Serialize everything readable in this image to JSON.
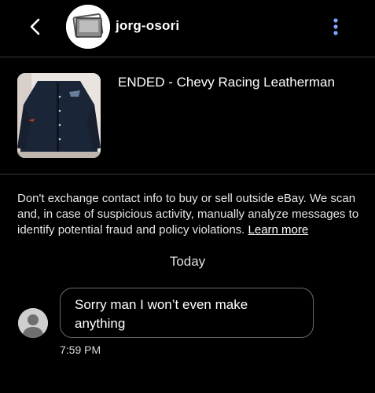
{
  "header": {
    "username": "jorg-osori"
  },
  "listing": {
    "title": "ENDED - Chevy Racing Leatherman"
  },
  "notice": {
    "text": "Don't exchange contact info to buy or sell outside eBay. We scan and, in case of suspicious activity, manually analyze messages to identify potential fraud and policy violations.",
    "link_label": "Learn more"
  },
  "conversation": {
    "day_label": "Today",
    "messages": [
      {
        "text": "Sorry man I won’t even make anything",
        "time": "7:59 PM"
      }
    ]
  },
  "icons": {
    "back": "chevron-left-icon",
    "menu": "more-vertical-icon",
    "avatar": "avatar-placeholder-icon"
  },
  "colors": {
    "background": "#000000",
    "text": "#ffffff",
    "menu_dots": "#7ea6ff",
    "bubble_border": "#6b6b6b",
    "divider": "#3a3a3a"
  }
}
